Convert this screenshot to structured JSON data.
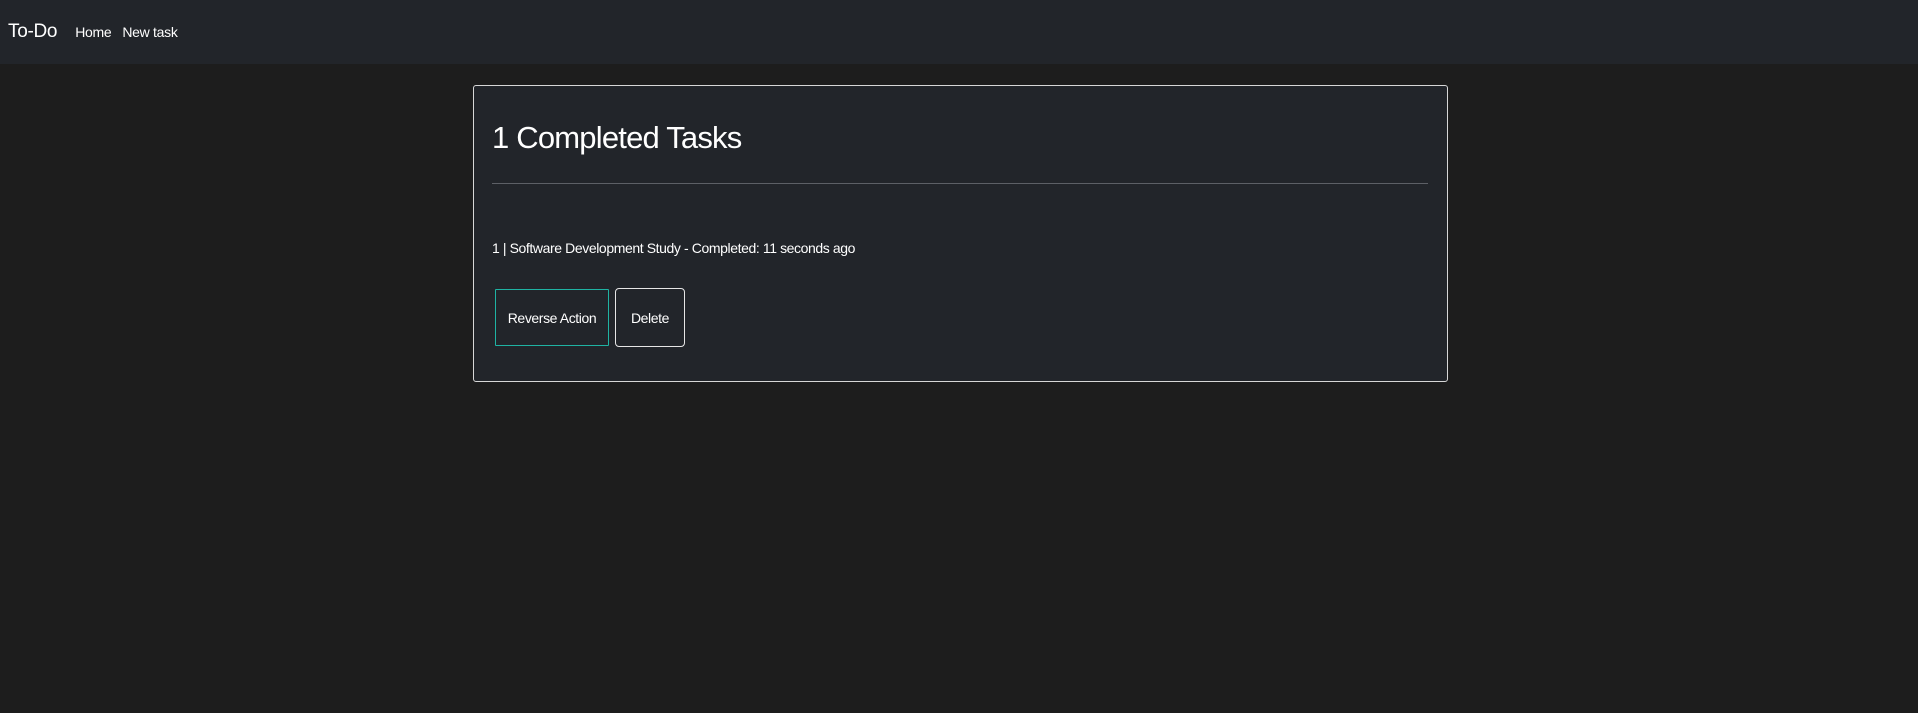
{
  "navbar": {
    "brand": "To-Do",
    "links": [
      {
        "label": "Home"
      },
      {
        "label": "New task"
      }
    ]
  },
  "main": {
    "title": "1 Completed Tasks",
    "tasks": [
      {
        "text": "1 | Software Development Study - Completed: 11 seconds ago",
        "reverse_label": "Reverse Action",
        "delete_label": "Delete"
      }
    ]
  },
  "colors": {
    "page_background": "#1d1d1d",
    "navbar_background": "#22252a",
    "card_background": "#22252a",
    "reverse_button_border": "#1fb3a3",
    "delete_button_border": "#e6e6e6"
  }
}
